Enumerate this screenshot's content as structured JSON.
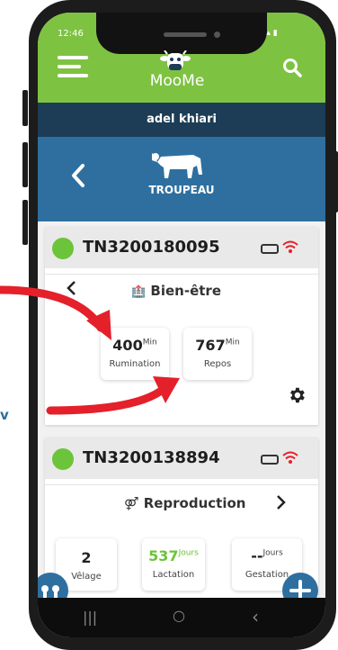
{
  "status_bar": {
    "time": "12:46",
    "icons": "◂ ▴ ▮"
  },
  "app": {
    "brand": "MooMe"
  },
  "user": {
    "name": "adel khiari"
  },
  "nav": {
    "title": "TROUPEAU"
  },
  "cards": [
    {
      "tag": "TN3200180095",
      "section": "Bien-être",
      "section_icon": "🏥",
      "metrics": [
        {
          "value": "400",
          "unit": "Min",
          "label": "Rumination"
        },
        {
          "value": "767",
          "unit": "Min",
          "label": "Repos"
        }
      ]
    },
    {
      "tag": "TN3200138894",
      "section": "Reproduction",
      "section_icon": "⚤",
      "metrics": [
        {
          "value": "2",
          "unit": "",
          "label": "Vêlage"
        },
        {
          "value": "537",
          "unit": "Jours",
          "label": "Lactation"
        },
        {
          "value": "--",
          "unit": "Jours",
          "label": "Gestation"
        }
      ]
    }
  ],
  "side_text": "v",
  "system_nav": {
    "recents": "|||",
    "home": "○",
    "back": "‹"
  },
  "colors": {
    "green": "#7ec242",
    "dark_blue": "#1d3c55",
    "blue": "#2e6f9f",
    "arrow_red": "#e4202a",
    "status_dot": "#6cc43a"
  }
}
